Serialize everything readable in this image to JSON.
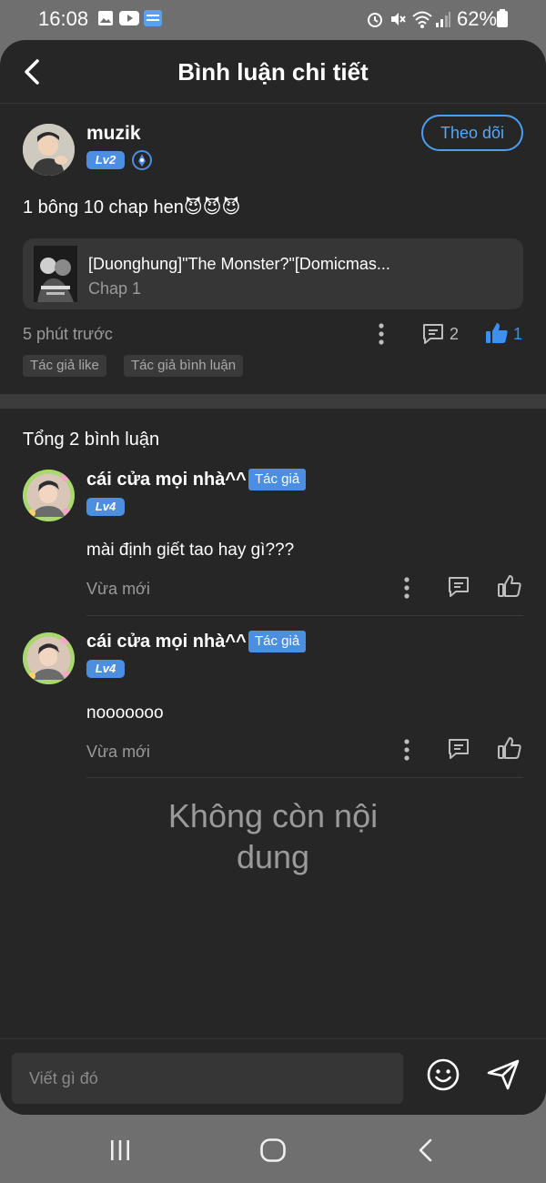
{
  "status_bar": {
    "time": "16:08",
    "battery": "62%",
    "left_icons": [
      "gallery-icon",
      "youtube-icon",
      "novel-toon-icon"
    ],
    "right_icons": [
      "alarm-icon",
      "mute-icon",
      "wifi-icon",
      "signal-icon",
      "battery-icon"
    ]
  },
  "header": {
    "title": "Bình luận chi tiết"
  },
  "post": {
    "username": "muzik",
    "level": "Lv2",
    "follow_label": "Theo dõi",
    "text": "1 bông 10 chap hen😈😈😈",
    "chapter": {
      "title": "[Duonghung]\"The Monster?\"[Domicmas...",
      "subtitle": "Chap 1"
    },
    "time": "5 phút trước",
    "comment_count": "2",
    "like_count": "1",
    "tags": [
      "Tác giả like",
      "Tác giả bình luận"
    ]
  },
  "comments_section": {
    "total_label": "Tổng 2 bình luận",
    "comments": [
      {
        "username": "cái cửa mọi nhà^^",
        "author_tag": "Tác giả",
        "level": "Lv4",
        "text": "mài định giết tao hay gì???",
        "time": "Vừa mới"
      },
      {
        "username": "cái cửa mọi nhà^^",
        "author_tag": "Tác giả",
        "level": "Lv4",
        "text": "nooooooo",
        "time": "Vừa mới"
      }
    ],
    "end_message": "Không còn nội dung"
  },
  "composer": {
    "placeholder": "Viết gì đó"
  },
  "colors": {
    "accent": "#4c8ee0",
    "like_blue": "#3d8ff0",
    "background": "#262626"
  }
}
